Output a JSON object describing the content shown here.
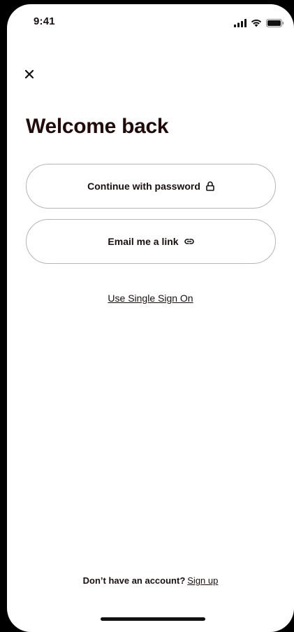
{
  "status_bar": {
    "time": "9:41",
    "icons": [
      "signal-icon",
      "wifi-icon",
      "battery-icon"
    ]
  },
  "header": {
    "close_icon": "close-icon"
  },
  "main": {
    "title": "Welcome back",
    "buttons": [
      {
        "label": "Continue with password",
        "icon": "lock-icon"
      },
      {
        "label": "Email me a link",
        "icon": "link-icon"
      }
    ],
    "sso_link": "Use Single Sign On"
  },
  "footer": {
    "prompt": "Don’t have an account?",
    "signup_link": "Sign up"
  },
  "colors": {
    "text": "#1a0f0f",
    "border": "#b9b3b3",
    "background": "#ffffff"
  }
}
